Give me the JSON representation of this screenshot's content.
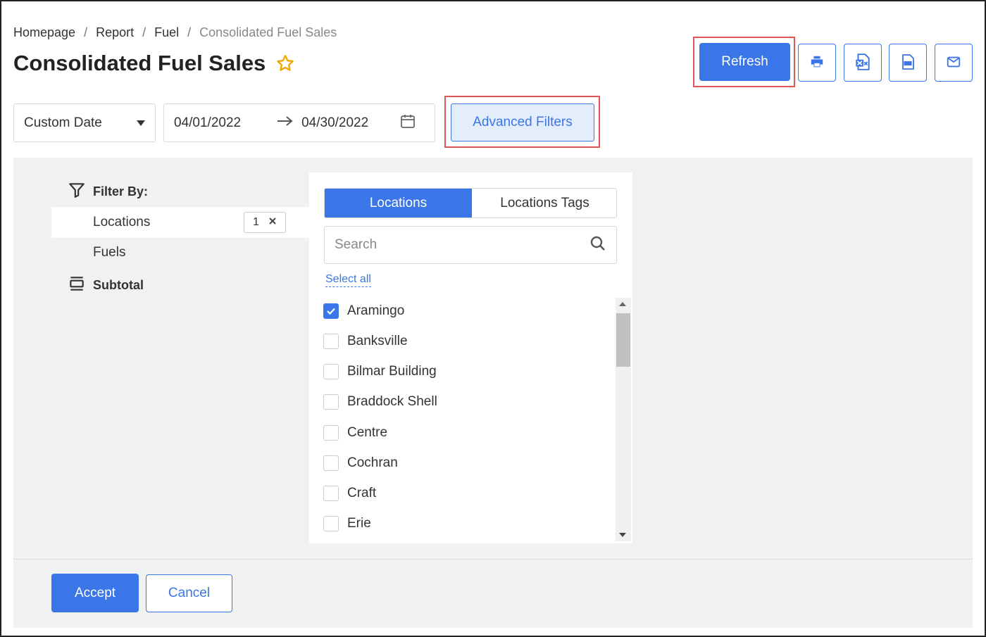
{
  "breadcrumb": {
    "items": [
      "Homepage",
      "Report",
      "Fuel"
    ],
    "separator": "/",
    "current": "Consolidated Fuel Sales"
  },
  "page": {
    "title": "Consolidated Fuel Sales",
    "favorite_icon": "star-icon"
  },
  "toolbar": {
    "refresh_label": "Refresh",
    "icons": [
      "print-icon",
      "excel-icon",
      "pdf-icon",
      "email-icon"
    ]
  },
  "date_filter": {
    "mode": "Custom Date",
    "start": "04/01/2022",
    "end": "04/30/2022"
  },
  "advanced_filters_label": "Advanced Filters",
  "filter_panel": {
    "filter_by_label": "Filter By:",
    "locations_label": "Locations",
    "locations_count": "1",
    "fuels_label": "Fuels",
    "subtotal_label": "Subtotal"
  },
  "locations_panel": {
    "tabs": [
      "Locations",
      "Locations Tags"
    ],
    "active_tab": "Locations",
    "search_placeholder": "Search",
    "select_all_label": "Select all",
    "items": [
      {
        "label": "Aramingo",
        "checked": true
      },
      {
        "label": "Banksville",
        "checked": false
      },
      {
        "label": "Bilmar Building",
        "checked": false
      },
      {
        "label": "Braddock Shell",
        "checked": false
      },
      {
        "label": "Centre",
        "checked": false
      },
      {
        "label": "Cochran",
        "checked": false
      },
      {
        "label": "Craft",
        "checked": false
      },
      {
        "label": "Erie",
        "checked": false
      }
    ]
  },
  "footer": {
    "accept_label": "Accept",
    "cancel_label": "Cancel"
  },
  "colors": {
    "accent": "#3b76e8",
    "highlight": "#e05555",
    "star": "#f0a500"
  }
}
